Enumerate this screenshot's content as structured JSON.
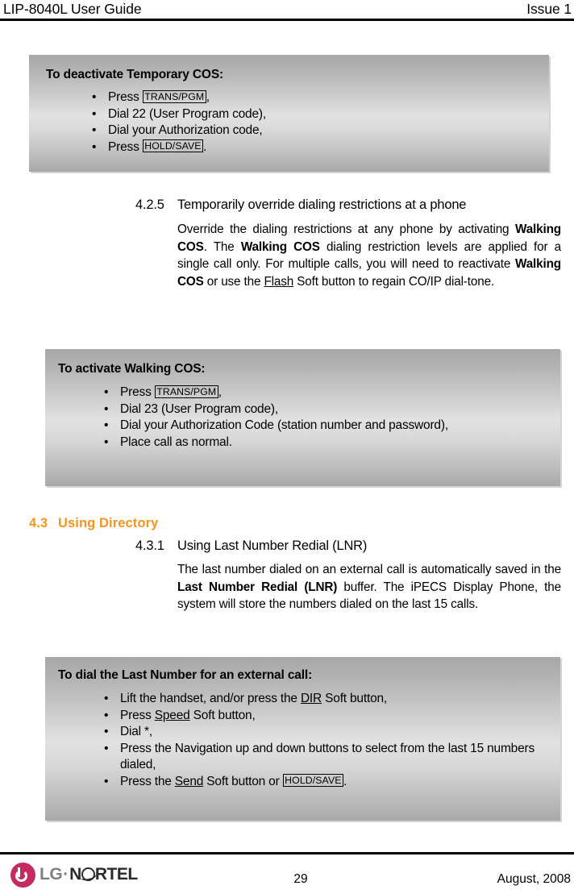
{
  "header": {
    "left": "LIP-8040L User Guide",
    "right": "Issue 1"
  },
  "callouts": {
    "deactivate_temp_cos": {
      "title": "To deactivate Temporary COS:",
      "items": [
        {
          "pre": "Press ",
          "key": "TRANS/PGM",
          "post": ","
        },
        {
          "pre": "Dial 22 (User Program code),",
          "key": "",
          "post": ""
        },
        {
          "pre": "Dial your Authorization code,",
          "key": "",
          "post": ""
        },
        {
          "pre": "Press ",
          "key": "HOLD/SAVE",
          "post": "."
        }
      ]
    },
    "activate_walking_cos": {
      "title": "To activate Walking COS:",
      "items": [
        {
          "pre": "Press ",
          "key": "TRANS/PGM",
          "post": ","
        },
        {
          "pre": "Dial 23 (User Program code),",
          "key": "",
          "post": ""
        },
        {
          "pre": "Dial your Authorization Code (station number and password),",
          "key": "",
          "post": ""
        },
        {
          "pre": "Place call as normal.",
          "key": "",
          "post": ""
        }
      ]
    },
    "dial_last_number": {
      "title": "To dial the Last Number for an external call:",
      "items": [
        {
          "pre": "Lift the handset, and/or press the ",
          "underline": "DIR",
          "post": " Soft button,"
        },
        {
          "pre": "Press ",
          "underline": "Speed",
          "post": " Soft button,"
        },
        {
          "pre": "Dial *,",
          "underline": "",
          "post": ""
        },
        {
          "pre": "Press the Navigation up and down buttons to select from the last 15 numbers dialed,",
          "underline": "",
          "post": ""
        },
        {
          "pre": "Press the ",
          "underline": "Send",
          "post": " Soft button or ",
          "key": "HOLD/SAVE",
          "post2": "."
        }
      ]
    }
  },
  "sections": [
    {
      "number": "4.2.5",
      "title": "Temporarily override dialing restrictions at a phone",
      "paragraph": {
        "p1": "Override the dialing restrictions at any phone by activating ",
        "b1": "Walking COS",
        "p2": ".  The ",
        "b2": "Walking COS",
        "p3": " dialing restriction levels are applied for a single call only.  For multiple calls, you will need to reactivate ",
        "b3": "Walking COS",
        "p4": " or use the ",
        "u1": "Flash",
        "p5": " Soft button to regain CO/IP dial-tone."
      }
    },
    {
      "number": "4.3.1",
      "title": "Using Last Number Redial (LNR)",
      "paragraph": {
        "p1": "The last number dialed on an external call is automatically saved in the ",
        "b1": "Last Number Redial (LNR)",
        "p2": " buffer.  The iPECS Display Phone, the system will store the numbers dialed on the last 15 calls."
      }
    }
  ],
  "main_heading": {
    "number": "4.3",
    "title": "Using Directory",
    "color": "#F7941E"
  },
  "footer": {
    "logo_lg": "LG",
    "logo_separator": "·",
    "logo_nortel_pre": "N",
    "logo_nortel_post": "RTEL",
    "page_number": "29",
    "date": "August, 2008",
    "logo_mark_color": "#C52B5E"
  }
}
